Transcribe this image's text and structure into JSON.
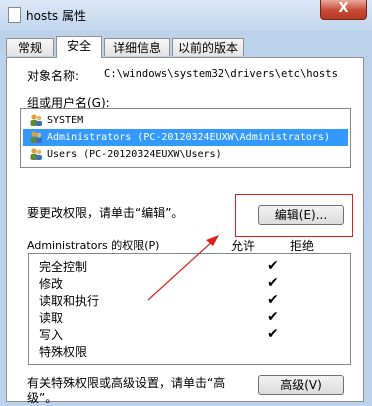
{
  "window": {
    "title": "hosts 属性",
    "close_label": "X"
  },
  "tabs": [
    {
      "label": "常规"
    },
    {
      "label": "安全",
      "active": true
    },
    {
      "label": "详细信息"
    },
    {
      "label": "以前的版本"
    }
  ],
  "security": {
    "object_name_label": "对象名称:",
    "object_name_value": "C:\\windows\\system32\\drivers\\etc\\hosts",
    "groups_label": "组或用户名(G):",
    "groups": [
      {
        "name": "SYSTEM",
        "icon": "users-group-icon"
      },
      {
        "name": "Administrators (PC-20120324EUXW\\Administrators)",
        "icon": "users-group-icon",
        "selected": true
      },
      {
        "name": "Users (PC-20120324EUXW\\Users)",
        "icon": "users-group-icon"
      }
    ],
    "change_hint": "要更改权限，请单击“编辑”。",
    "edit_button": "编辑(E)...",
    "perm_for_label": "Administrators 的权限(P)",
    "allow_header": "允许",
    "deny_header": "拒绝",
    "permissions": [
      {
        "name": "完全控制",
        "allow": true
      },
      {
        "name": "修改",
        "allow": true
      },
      {
        "name": "读取和执行",
        "allow": true
      },
      {
        "name": "读取",
        "allow": true
      },
      {
        "name": "写入",
        "allow": true
      },
      {
        "name": "特殊权限",
        "allow": false
      }
    ],
    "check_glyph": "✔",
    "special_hint_line1": "有关特殊权限或高级设置，请单击“高",
    "special_hint_line2": "级”。",
    "advanced_button": "高级(V)"
  },
  "colors": {
    "accent_selection": "#3399ff",
    "annotation_red": "#e0211b"
  }
}
